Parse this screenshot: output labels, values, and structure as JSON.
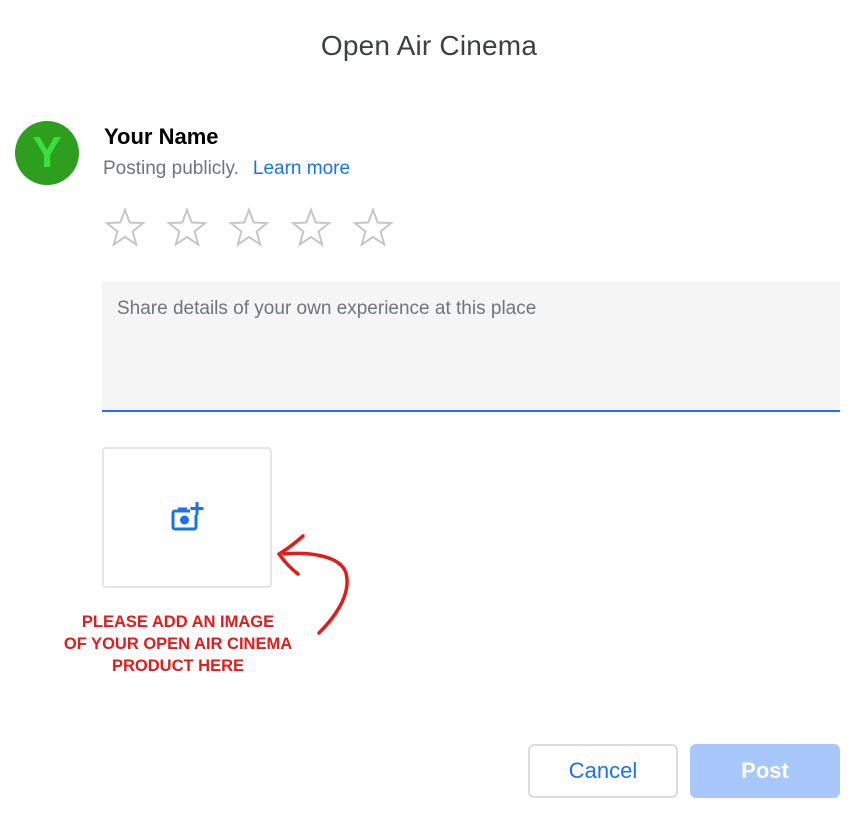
{
  "dialog": {
    "title": "Open Air Cinema"
  },
  "user": {
    "avatar_letter": "Y",
    "name": "Your Name",
    "posting_status": "Posting publicly.",
    "learn_more_label": "Learn more"
  },
  "rating": {
    "max_stars": 5,
    "selected": 0
  },
  "review": {
    "placeholder": "Share details of your own experience at this place",
    "value": ""
  },
  "photo": {
    "icon": "add-photo-icon"
  },
  "annotation": {
    "line1": "PLEASE ADD AN IMAGE",
    "line2": "OF YOUR OPEN AIR CINEMA",
    "line3": "PRODUCT HERE"
  },
  "actions": {
    "cancel_label": "Cancel",
    "post_label": "Post"
  },
  "colors": {
    "accent": "#1a73e8",
    "post_disabled": "#a8c7fa",
    "avatar_bg": "#2e9e1e",
    "annotation": "#e31b1b"
  }
}
